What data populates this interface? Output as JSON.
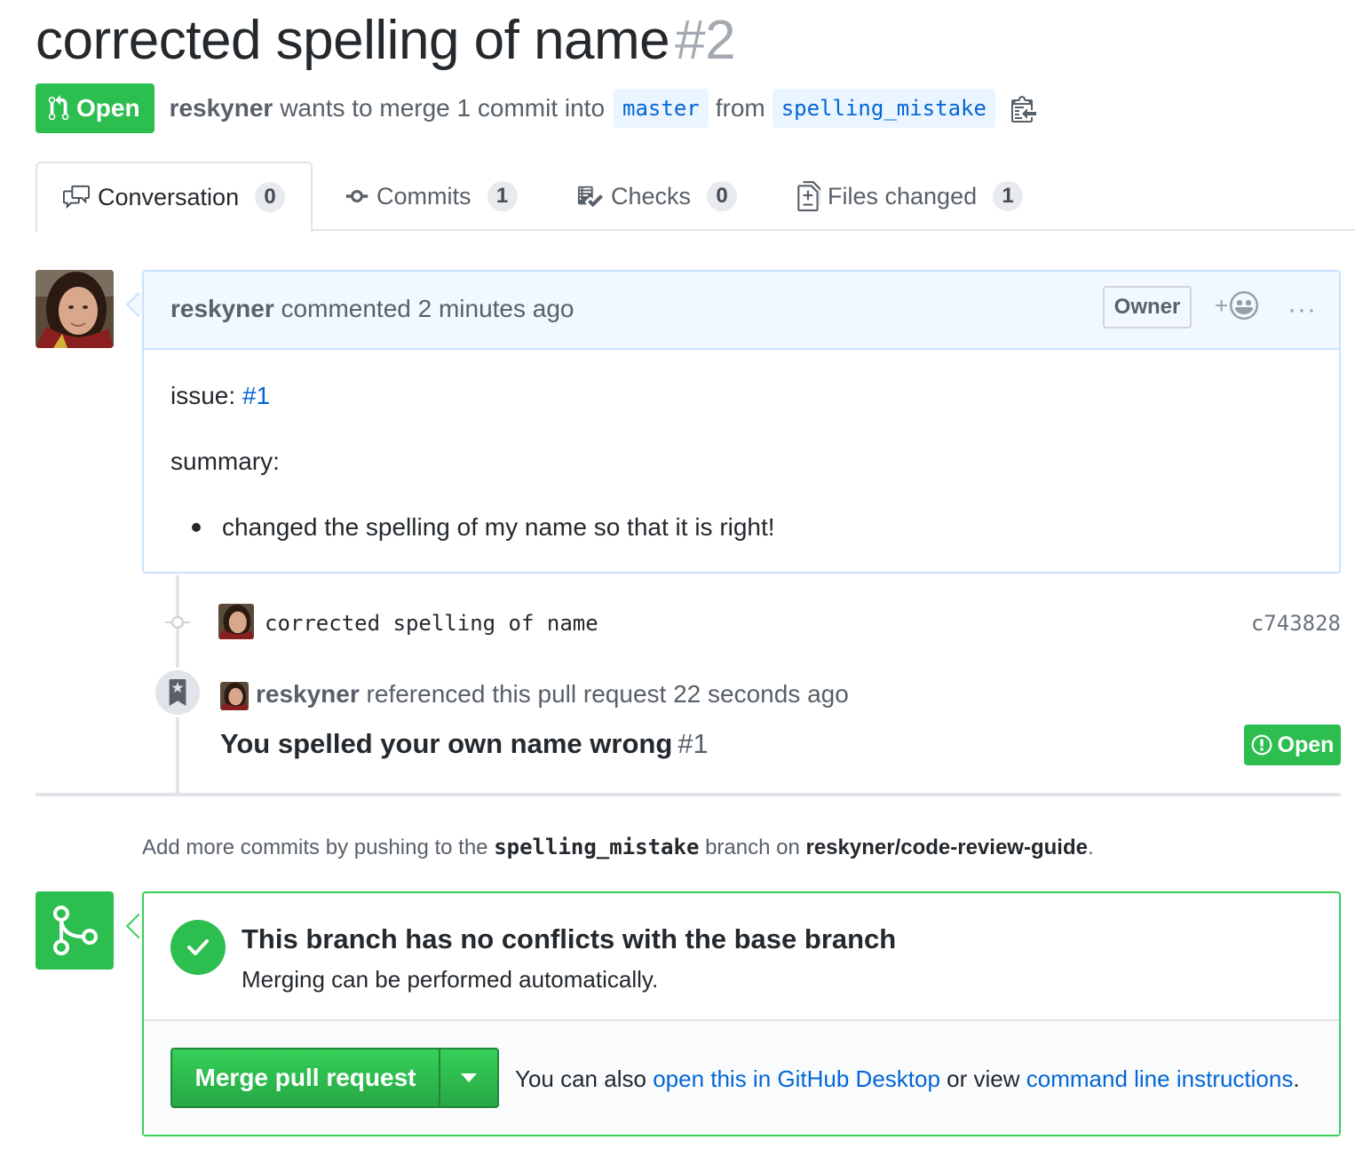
{
  "pr": {
    "title": "corrected spelling of name",
    "number": "#2",
    "state": "Open",
    "author": "reskyner",
    "merge_text": "wants to merge 1 commit into",
    "base_branch": "master",
    "from_text": "from",
    "head_branch": "spelling_mistake"
  },
  "tabs": [
    {
      "label": "Conversation",
      "count": "0",
      "icon": "comment-discussion-icon"
    },
    {
      "label": "Commits",
      "count": "1",
      "icon": "git-commit-icon"
    },
    {
      "label": "Checks",
      "count": "0",
      "icon": "checklist-icon"
    },
    {
      "label": "Files changed",
      "count": "1",
      "icon": "diff-icon"
    }
  ],
  "comment": {
    "author": "reskyner",
    "action": "commented 2 minutes ago",
    "role": "Owner",
    "reaction": "+",
    "more": "···",
    "issue_label": "issue:",
    "issue_link": "#1",
    "summary_label": "summary:",
    "bullet": "changed the spelling of my name so that it is right!"
  },
  "commit": {
    "message": "corrected spelling of name",
    "sha": "c743828"
  },
  "reference": {
    "author": "reskyner",
    "action": "referenced this pull request 22 seconds ago",
    "title": "You spelled your own name wrong",
    "number": "#1",
    "state": "Open"
  },
  "push_hint": {
    "prefix": "Add more commits by pushing to the",
    "branch": "spelling_mistake",
    "middle": "branch on",
    "repo": "reskyner/code-review-guide",
    "suffix": "."
  },
  "merge": {
    "heading": "This branch has no conflicts with the base branch",
    "sub": "Merging can be performed automatically.",
    "button": "Merge pull request",
    "alt_prefix": "You can also",
    "alt_link1": "open this in GitHub Desktop",
    "alt_middle": "or view",
    "alt_link2": "command line instructions",
    "alt_suffix": "."
  },
  "colors": {
    "green": "#2cbe4e",
    "link_blue": "#0366d6",
    "comment_header_bg": "#f1f8ff",
    "comment_border": "#c8e1ff"
  }
}
